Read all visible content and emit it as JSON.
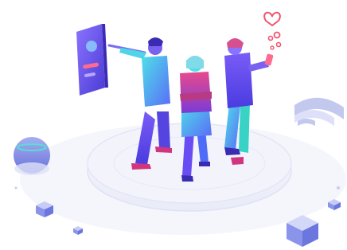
{
  "illustration": {
    "kind": "isometric-people-smart-devices",
    "palette": {
      "violet": "#6a4df2",
      "blue": "#4f6cf7",
      "cyan": "#49d9e6",
      "teal": "#39d3c5",
      "magenta": "#d63b84",
      "pink": "#f26a8b",
      "shadow": "#e6e8f7",
      "platform": "#eef0fb"
    },
    "elements": [
      "tablet-panel",
      "three-people",
      "phone",
      "heart-bubbles",
      "wifi-symbol",
      "smart-speaker",
      "floating-cubes"
    ]
  }
}
